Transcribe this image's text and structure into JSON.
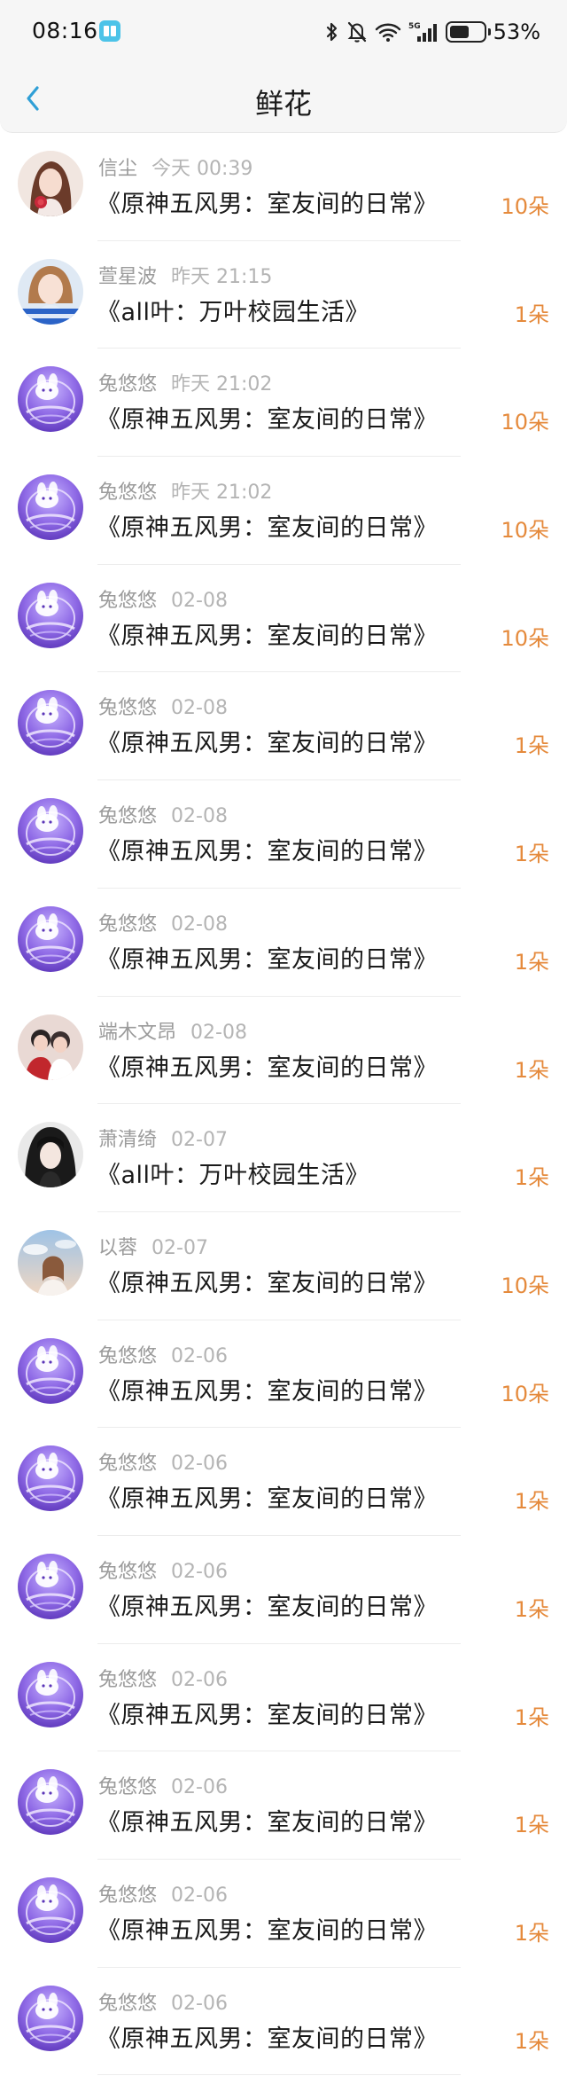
{
  "status_bar": {
    "time": "08:16",
    "battery_pct": "53%",
    "network": "5G",
    "battery_level": 0.53
  },
  "nav": {
    "title": "鲜花"
  },
  "colors": {
    "accent": "#2f9fd6",
    "count": "#e58a3c",
    "meta": "#9b9b9b",
    "avatar_purple": "#7d56d6"
  },
  "items": [
    {
      "user": "信尘",
      "time": "今天 00:39",
      "title": "《原神五风男：室友间的日常》",
      "count": "10朵",
      "avatar": "portrait-rose"
    },
    {
      "user": "萱星波",
      "time": "昨天 21:15",
      "title": "《all叶：万叶校园生活》",
      "count": "1朵",
      "avatar": "portrait-girl"
    },
    {
      "user": "兔悠悠",
      "time": "昨天 21:02",
      "title": "《原神五风男：室友间的日常》",
      "count": "10朵",
      "avatar": "purple-bunny"
    },
    {
      "user": "兔悠悠",
      "time": "昨天 21:02",
      "title": "《原神五风男：室友间的日常》",
      "count": "10朵",
      "avatar": "purple-bunny"
    },
    {
      "user": "兔悠悠",
      "time": "02-08",
      "title": "《原神五风男：室友间的日常》",
      "count": "10朵",
      "avatar": "purple-bunny"
    },
    {
      "user": "兔悠悠",
      "time": "02-08",
      "title": "《原神五风男：室友间的日常》",
      "count": "1朵",
      "avatar": "purple-bunny"
    },
    {
      "user": "兔悠悠",
      "time": "02-08",
      "title": "《原神五风男：室友间的日常》",
      "count": "1朵",
      "avatar": "purple-bunny"
    },
    {
      "user": "兔悠悠",
      "time": "02-08",
      "title": "《原神五风男：室友间的日常》",
      "count": "1朵",
      "avatar": "purple-bunny"
    },
    {
      "user": "端木文昂",
      "time": "02-08",
      "title": "《原神五风男：室友间的日常》",
      "count": "1朵",
      "avatar": "portrait-couple"
    },
    {
      "user": "萧清绮",
      "time": "02-07",
      "title": "《all叶：万叶校园生活》",
      "count": "1朵",
      "avatar": "portrait-dark"
    },
    {
      "user": "以蓉",
      "time": "02-07",
      "title": "《原神五风男：室友间的日常》",
      "count": "10朵",
      "avatar": "portrait-sky"
    },
    {
      "user": "兔悠悠",
      "time": "02-06",
      "title": "《原神五风男：室友间的日常》",
      "count": "10朵",
      "avatar": "purple-bunny"
    },
    {
      "user": "兔悠悠",
      "time": "02-06",
      "title": "《原神五风男：室友间的日常》",
      "count": "1朵",
      "avatar": "purple-bunny"
    },
    {
      "user": "兔悠悠",
      "time": "02-06",
      "title": "《原神五风男：室友间的日常》",
      "count": "1朵",
      "avatar": "purple-bunny"
    },
    {
      "user": "兔悠悠",
      "time": "02-06",
      "title": "《原神五风男：室友间的日常》",
      "count": "1朵",
      "avatar": "purple-bunny"
    },
    {
      "user": "兔悠悠",
      "time": "02-06",
      "title": "《原神五风男：室友间的日常》",
      "count": "1朵",
      "avatar": "purple-bunny"
    },
    {
      "user": "兔悠悠",
      "time": "02-06",
      "title": "《原神五风男：室友间的日常》",
      "count": "1朵",
      "avatar": "purple-bunny"
    },
    {
      "user": "兔悠悠",
      "time": "02-06",
      "title": "《原神五风男：室友间的日常》",
      "count": "1朵",
      "avatar": "purple-bunny"
    }
  ]
}
